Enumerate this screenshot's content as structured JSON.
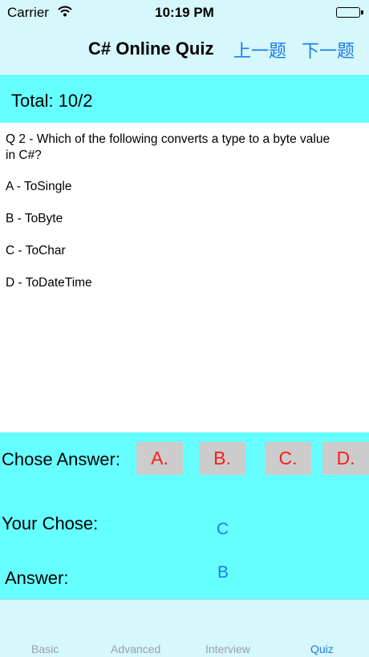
{
  "status": {
    "carrier": "Carrier",
    "time": "10:19 PM"
  },
  "nav": {
    "title": "C# Online Quiz",
    "prev_label": "上一题",
    "next_label": "下一题"
  },
  "total": {
    "text": "Total:  10/2"
  },
  "question": {
    "text": "Q 2 - Which of the following converts a type to a byte value in C#?",
    "options": [
      "A - ToSingle",
      "B - ToByte",
      "C - ToChar",
      "D - ToDateTime"
    ]
  },
  "answer": {
    "chose_label": "Chose Answer:",
    "choices": [
      "A.",
      "B.",
      "C.",
      "D."
    ],
    "your_chose_label": "Your Chose:",
    "your_chose_value": "C",
    "answer_label": "Answer:",
    "answer_value": "B"
  },
  "tabs": [
    {
      "label": "Basic"
    },
    {
      "label": "Advanced"
    },
    {
      "label": "Interview"
    },
    {
      "label": "Quiz"
    }
  ],
  "colors": {
    "accent": "#1a7cf0",
    "panel": "#66ffff",
    "bars": "#d6f7fb",
    "choice_text": "#ff1a1a"
  }
}
